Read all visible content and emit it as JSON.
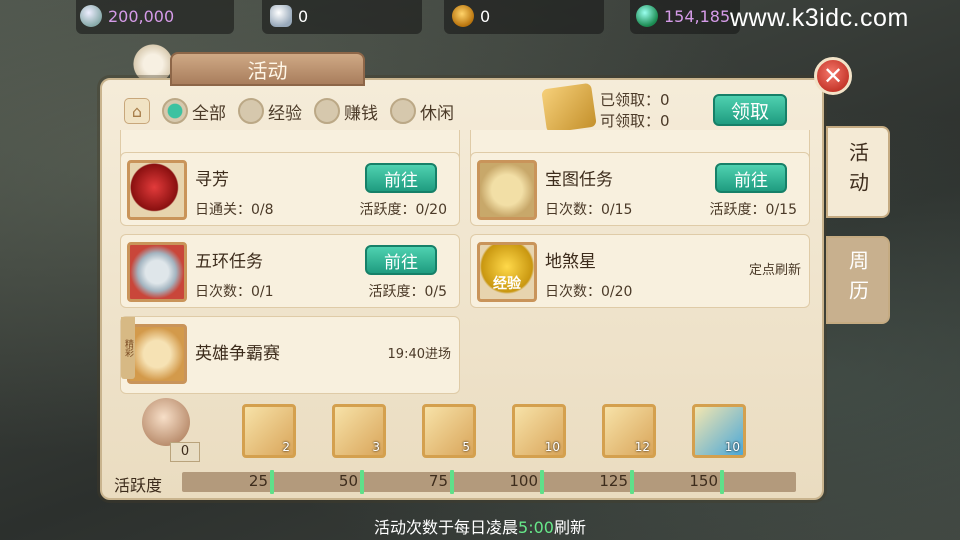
{
  "currencies": [
    {
      "icon": "silver-coin-icon",
      "value": "200,000"
    },
    {
      "icon": "silver-ingot-icon",
      "value": "0"
    },
    {
      "icon": "copper-coin-icon",
      "value": "0"
    },
    {
      "icon": "jade-money-icon",
      "value": "154,185"
    }
  ],
  "watermark": "www.k3idc.com",
  "panel": {
    "title": "活动",
    "close_icon": "✕"
  },
  "filters": {
    "home_icon": "⌂",
    "options": [
      {
        "label": "全部",
        "selected": true
      },
      {
        "label": "经验",
        "selected": false
      },
      {
        "label": "赚钱",
        "selected": false
      },
      {
        "label": "休闲",
        "selected": false
      }
    ]
  },
  "claim": {
    "claimed": "已领取：0",
    "claimable": "可领取：0",
    "button": "领取"
  },
  "activities": [
    {
      "name": "寻芳",
      "line1": "日通关：0/8",
      "line2": "活跃度：0/20",
      "button": "前往",
      "icon": "red-flower-icon"
    },
    {
      "name": "宝图任务",
      "line1": "日次数：0/15",
      "line2": "活跃度：0/15",
      "button": "前往",
      "icon": "treasure-map-icon"
    },
    {
      "name": "五环任务",
      "line1": "日次数：0/1",
      "line2": "活跃度：0/5",
      "button": "前往",
      "icon": "teapot-icon"
    },
    {
      "name": "地煞星",
      "line1": "日次数：0/20",
      "note": "定点刷新",
      "icon": "exp-gourd-icon",
      "icon_text": "经验"
    },
    {
      "name": "英雄争霸赛",
      "note": "19:40进场",
      "tag": "精彩",
      "icon": "hero-battle-icon"
    }
  ],
  "side_tabs": [
    {
      "label": "活动",
      "active": true
    },
    {
      "label": "周历",
      "active": false
    }
  ],
  "rewards": {
    "current_activity": "0",
    "chests": [
      {
        "count": "2",
        "icon": "reward-chest-icon"
      },
      {
        "count": "3",
        "icon": "reward-chest-icon"
      },
      {
        "count": "5",
        "icon": "reward-chest-icon"
      },
      {
        "count": "10",
        "icon": "reward-chest-icon"
      },
      {
        "count": "12",
        "icon": "reward-chest-icon"
      },
      {
        "count": "10",
        "icon": "scroll-reward-icon"
      }
    ]
  },
  "activity_bar": {
    "label": "活跃度",
    "progress_fraction": 0,
    "milestones": [
      "25",
      "50",
      "75",
      "100",
      "125",
      "150"
    ]
  },
  "footer": {
    "prefix": "活动次数于每日凌晨",
    "time": "5:00",
    "suffix": "刷新"
  }
}
